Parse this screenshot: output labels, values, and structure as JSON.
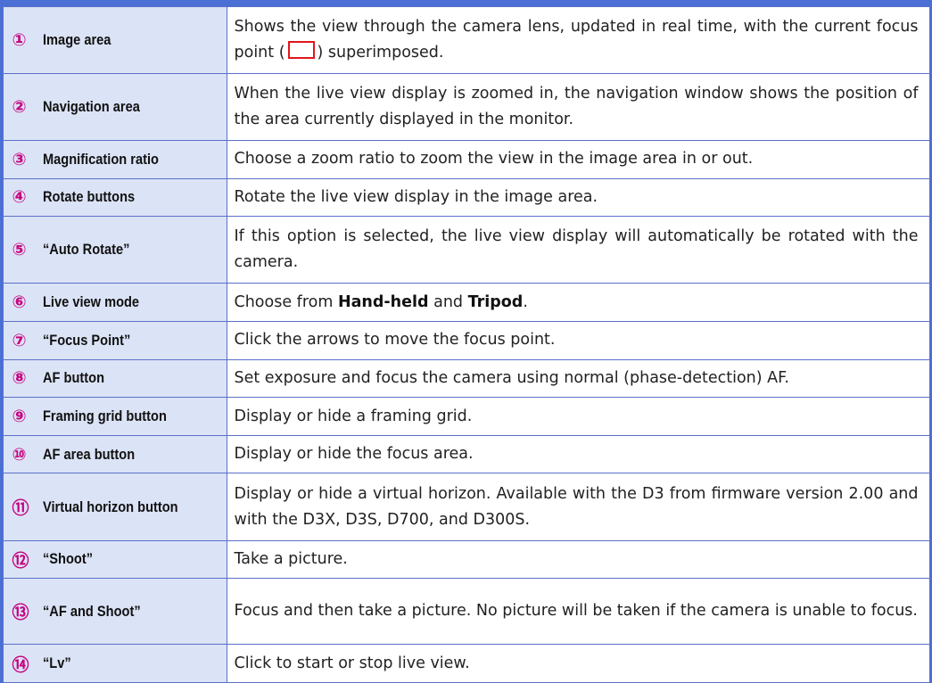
{
  "rows": [
    {
      "num": "①",
      "item": "Image area",
      "desc_before": "Shows the view through the camera lens, updated in real time, with the current focus point (",
      "desc_icon": "focus-point-box-icon",
      "desc_after": ") superimposed."
    },
    {
      "num": "②",
      "item": "Navigation area",
      "desc": "When the live view display is zoomed in, the navigation window shows the position of the area currently displayed in the monitor."
    },
    {
      "num": "③",
      "item": "Magnification ratio",
      "desc": "Choose a zoom ratio to zoom the view in the image area in or out."
    },
    {
      "num": "④",
      "item": "Rotate buttons",
      "desc": "Rotate the live view display in the image area."
    },
    {
      "num": "⑤",
      "item": "“Auto Rotate”",
      "desc": "If this option is selected, the live view display will automatically be rotated with the camera."
    },
    {
      "num": "⑥",
      "item": "Live view mode",
      "desc_before": "Choose from ",
      "desc_bold1": "Hand-held",
      "desc_mid": " and ",
      "desc_bold2": "Tripod",
      "desc_after": "."
    },
    {
      "num": "⑦",
      "item": "“Focus Point”",
      "desc": "Click the arrows to move the focus point."
    },
    {
      "num": "⑧",
      "item": "AF button",
      "desc": "Set exposure and focus the camera using normal (phase-detection) AF."
    },
    {
      "num": "⑨",
      "item": "Framing grid button",
      "desc": "Display or hide a framing grid."
    },
    {
      "num": "⑩",
      "item": "AF area button",
      "desc": "Display or hide the focus area."
    },
    {
      "num": "⑪",
      "item": "Virtual horizon button",
      "desc": "Display or hide a virtual horizon. Available with the D3 from firmware version 2.00 and with the D3X, D3S, D700, and D300S."
    },
    {
      "num": "⑫",
      "item": "“Shoot”",
      "desc": "Take a picture."
    },
    {
      "num": "⑬",
      "item": "“AF and Shoot”",
      "desc": "Focus and then take a picture. No picture will be taken if the camera is unable to focus."
    },
    {
      "num": "⑭",
      "item": "“Lv”",
      "desc": "Click to start or stop live view."
    }
  ],
  "colors": {
    "accent": "#4b6fd4",
    "number": "#c6007e",
    "item_bg": "#dbe3f6",
    "focus_box": "#e0161c"
  }
}
